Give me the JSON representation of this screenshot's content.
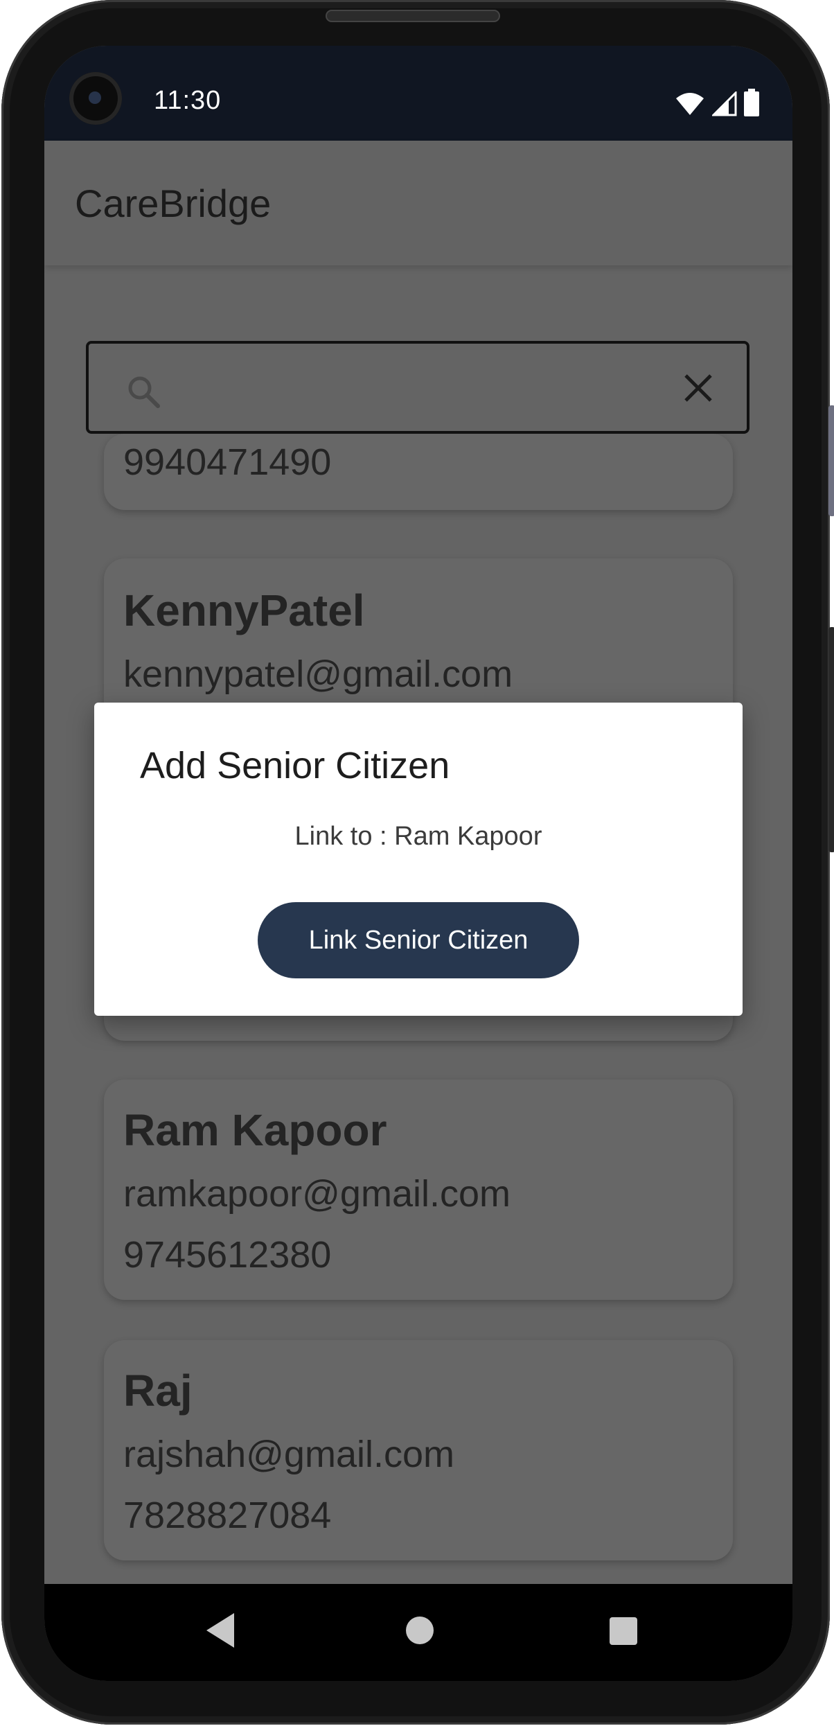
{
  "status_bar": {
    "time": "11:30",
    "icons": [
      "wifi-icon",
      "signal-icon",
      "battery-icon"
    ]
  },
  "app_bar": {
    "title": "CareBridge"
  },
  "search": {
    "placeholder": "",
    "value": ""
  },
  "contacts": [
    {
      "name": "",
      "email": "",
      "phone": "9940471490"
    },
    {
      "name": "KennyPatel",
      "email": "kennypatel@gmail.com",
      "phone": ""
    },
    {
      "name": "Ram Kapoor",
      "email": "ramkapoor@gmail.com",
      "phone": "9745612380"
    },
    {
      "name": "Raj",
      "email": "rajshah@gmail.com",
      "phone": "7828827084"
    }
  ],
  "dialog": {
    "title": "Add Senior Citizen",
    "text": "Link to : Ram Kapoor",
    "button_label": "Link Senior Citizen"
  },
  "colors": {
    "status_bar": "#101622",
    "scrim_background": "#646464",
    "dialog_button": "#27374f",
    "dialog_background": "#ffffff"
  },
  "nav_bar": {
    "icons": [
      "back-icon",
      "home-icon",
      "recents-icon"
    ]
  }
}
